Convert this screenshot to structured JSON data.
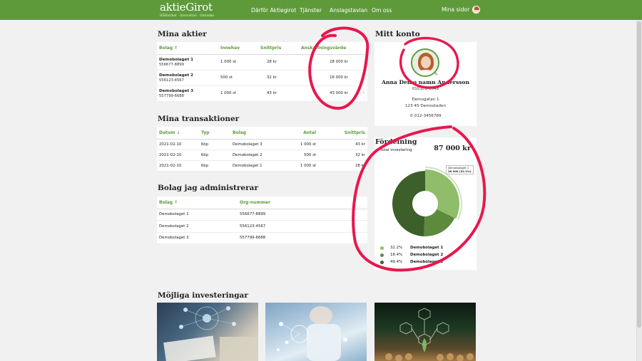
{
  "header": {
    "logo_text": "aktieGirot",
    "logo_tagline": "Hållbarhet · Innovation · Omtanke",
    "nav": [
      "Därför Aktiegirot",
      "Tjänster",
      "Anslagstavlan",
      "Om oss"
    ],
    "my_pages": "Mina sidor"
  },
  "colors": {
    "brand": "#5f9a3a",
    "pie_1": "#8fbd6a",
    "pie_2": "#5e8a3e",
    "pie_3": "#3d5f2a",
    "annotation": "#e8174d"
  },
  "my_shares": {
    "title": "Mina aktier",
    "headers": [
      "Bolag ↑",
      "Innehav",
      "Snittpris",
      "Anskaffningsvärde"
    ],
    "rows": [
      {
        "name": "Demobolaget 1",
        "org": "556677-8899",
        "holding": "1 000 st",
        "avg": "28 kr",
        "value": "28 000 kr"
      },
      {
        "name": "Demobolaget 2",
        "org": "556123-4567",
        "holding": "500 st",
        "avg": "32 kr",
        "value": "16 000 kr"
      },
      {
        "name": "Demobolaget 3",
        "org": "557799-6688",
        "holding": "1 000 st",
        "avg": "43 kr",
        "value": "43 000 kr"
      }
    ]
  },
  "transactions": {
    "title": "Mina transaktioner",
    "headers": [
      "Datum ↓",
      "Typ",
      "Bolag",
      "Antal",
      "Snittpris"
    ],
    "rows": [
      {
        "date": "2021-02-10",
        "type": "Köp",
        "company": "Demobolaget 3",
        "qty": "1 000 st",
        "price": "43 kr"
      },
      {
        "date": "2021-02-10",
        "type": "Köp",
        "company": "Demobolaget 2",
        "qty": "500 st",
        "price": "32 kr"
      },
      {
        "date": "2021-02-10",
        "type": "Köp",
        "company": "Demobolaget 1",
        "qty": "1 000 st",
        "price": "28 kr"
      }
    ]
  },
  "admin": {
    "title": "Bolag jag administrerar",
    "headers": [
      "Bolag ↑",
      "Org-nummer"
    ],
    "rows": [
      {
        "name": "Demobolaget 1",
        "org": "556677-8899"
      },
      {
        "name": "Demobolaget 2",
        "org": "556123-4567"
      },
      {
        "name": "Demobolaget 3",
        "org": "557799-6688"
      }
    ]
  },
  "account": {
    "title": "Mitt konto",
    "name": "Anna Demo namn Andersson",
    "personal_number": "010101-3548",
    "street": "Demogatan 1",
    "city": "123 45 Demostaden",
    "phone": "012-3456789"
  },
  "distribution": {
    "title": "Fördelning",
    "total_label": "Total investering",
    "total_value": "87 000 kr",
    "tooltip_name": "Demobolaget 1",
    "tooltip_value": "28 000 (32.2%)",
    "legend": [
      {
        "pct": "32.2%",
        "name": "Demobolaget 1"
      },
      {
        "pct": "18.4%",
        "name": "Demobolaget 2"
      },
      {
        "pct": "49.4%",
        "name": "Demobolaget 3"
      }
    ]
  },
  "chart_data": {
    "type": "pie",
    "categories": [
      "Demobolaget 1",
      "Demobolaget 2",
      "Demobolaget 3"
    ],
    "values": [
      32.2,
      18.4,
      49.4
    ]
  },
  "investments": {
    "title": "Möjliga investeringar"
  }
}
